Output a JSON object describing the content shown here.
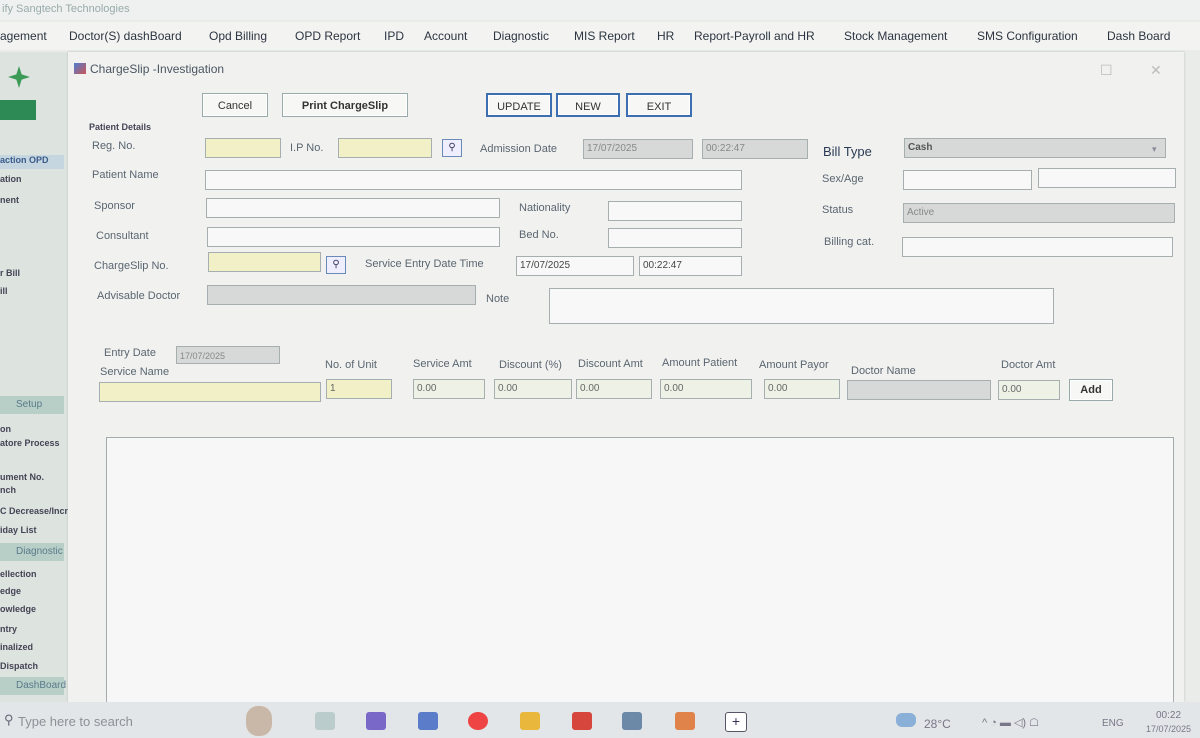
{
  "app_title": "ify Sangtech Technologies",
  "menu": [
    "agement",
    "Doctor(S) dashBoard",
    "Opd Billing",
    "OPD Report",
    "IPD",
    "Account",
    "Diagnostic",
    "MIS Report",
    "HR",
    "Report-Payroll and HR",
    "Stock Management",
    "SMS Configuration",
    "Dash Board"
  ],
  "left_panel": {
    "items": [
      "action OPD",
      "ation",
      "nent",
      "r Bill",
      "ill",
      "on",
      "atore Process",
      "ument No.",
      "nch",
      "C Decrease/Increa",
      "iday List",
      "ellection",
      "edge",
      "owledge",
      "ntry",
      "inalized",
      "Dispatch"
    ],
    "bands": [
      "Setup",
      "Diagnostic",
      "DashBoard"
    ]
  },
  "dialog": {
    "title": "ChargeSlip -Investigation",
    "buttons": {
      "cancel": "Cancel",
      "print": "Print ChargeSlip",
      "update": "UPDATE",
      "new": "NEW",
      "exit": "EXIT"
    },
    "section": "Patient Details",
    "labels": {
      "reg_no": "Reg. No.",
      "ip_no": "I.P No.",
      "admission_date": "Admission Date",
      "bill_type": "Bill Type",
      "patient_name": "Patient Name",
      "sex_age": "Sex/Age",
      "sponsor": "Sponsor",
      "nationality": "Nationality",
      "status": "Status",
      "consultant": "Consultant",
      "bed_no": "Bed No.",
      "billing_cat": "Billing cat.",
      "chargeslip_no": "ChargeSlip No.",
      "service_entry": "Service Entry Date Time",
      "advisable_doctor": "Advisable Doctor",
      "note": "Note"
    },
    "values": {
      "admission_date": "17/07/2025",
      "admission_time": "00:22:47",
      "bill_type": "Cash",
      "status": "Active",
      "service_date": "17/07/2025",
      "service_time": "00:22:47"
    },
    "entry": {
      "entry_date_label": "Entry Date",
      "entry_date": "17/07/2025",
      "service_name": "Service Name",
      "no_of_unit": "No. of Unit",
      "service_amt": "Service Amt",
      "discount_pct": "Discount (%)",
      "discount_amt": "Discount Amt",
      "amount_patient": "Amount Patient",
      "amount_payor": "Amount Payor",
      "doctor_name": "Doctor Name",
      "doctor_amt": "Doctor Amt",
      "unit_value": "1",
      "service_amt_val": "0.00",
      "discount_pct_val": "0.00",
      "discount_amt_val": "0.00",
      "amount_patient_val": "0.00",
      "amount_payor_val": "0.00",
      "doctor_amt_val": "0.00",
      "add": "Add"
    }
  },
  "taskbar": {
    "search": "Type here to search",
    "temp": "28°C",
    "lang": "ENG",
    "time": "00:22",
    "date": "17/07/2025"
  },
  "colors": {
    "field_yellow": "#f1f0c6",
    "button_border": "#3d6fb0",
    "left_band": "#b8cfc8"
  }
}
